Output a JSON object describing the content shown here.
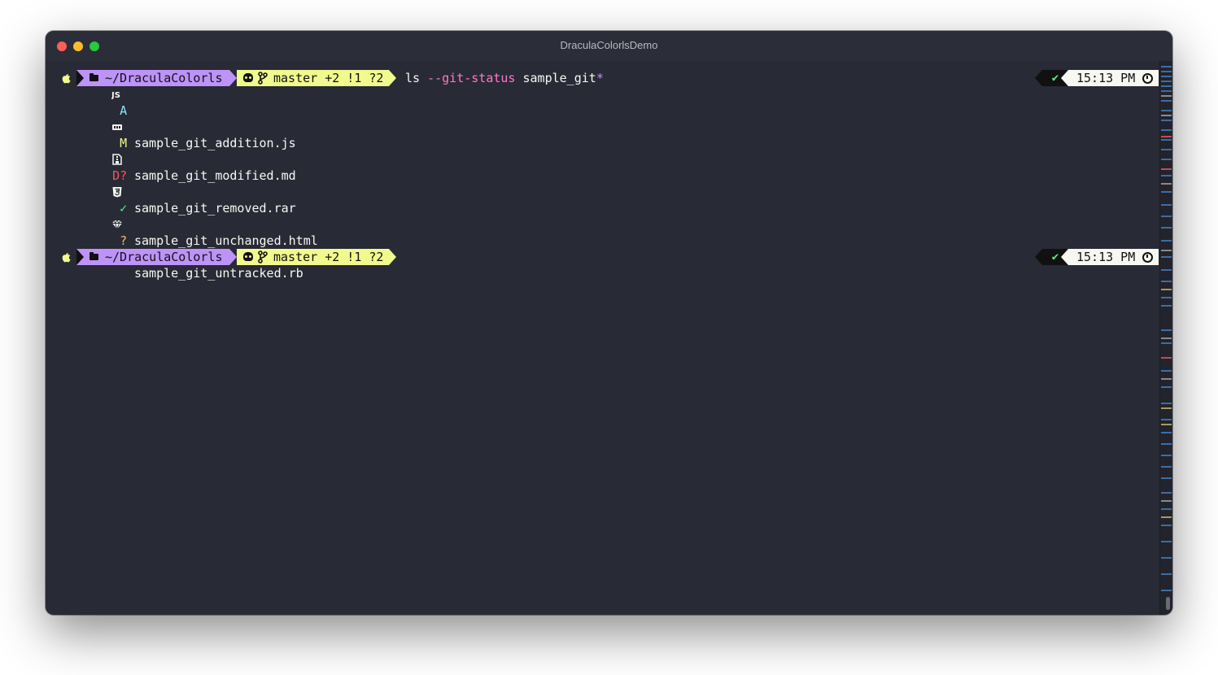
{
  "window": {
    "title": "DraculaColorlsDemo"
  },
  "prompt1": {
    "directory": "~/DraculaColorls",
    "git_status": "master +2 !1 ?2",
    "command": {
      "name": "ls",
      "flag": "--git-status",
      "arg": "sample_git",
      "suffix": "*"
    },
    "exit_status": "✔",
    "time": "15:13 PM"
  },
  "files": [
    {
      "status": "A",
      "status_color": "#8be9fd",
      "icon": "javascript-icon",
      "name": "sample_git_addition.js"
    },
    {
      "status": "M",
      "status_color": "#f1fa8c",
      "icon": "markdown-icon",
      "name": "sample_git_modified.md"
    },
    {
      "status": "D?",
      "status_color": "#ff5555",
      "icon": "archive-icon",
      "name": "sample_git_removed.rar"
    },
    {
      "status": "✓",
      "status_color": "#50fa7b",
      "icon": "html5-icon",
      "name": "sample_git_unchanged.html"
    },
    {
      "status": "?",
      "status_color": "#ffb86c",
      "icon": "ruby-gem-icon",
      "name": "sample_git_untracked.rb"
    }
  ],
  "prompt2": {
    "directory": "~/DraculaColorls",
    "git_status": "master +2 !1 ?2",
    "exit_status": "✔",
    "time": "15:13 PM"
  },
  "colors": {
    "background": "#282a36",
    "purple": "#bd93f9",
    "yellow": "#f1fa8c",
    "pink": "#ff79c6",
    "green": "#50fa7b",
    "foreground": "#f8f8f2"
  }
}
